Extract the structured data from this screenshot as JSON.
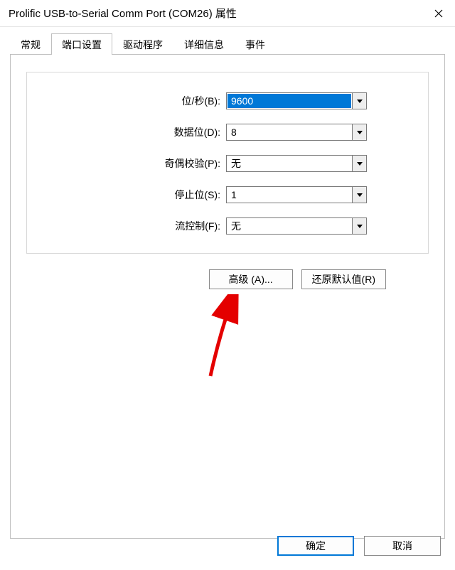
{
  "window": {
    "title": "Prolific USB-to-Serial Comm Port (COM26) 属性"
  },
  "tabs": {
    "general": "常规",
    "port_settings": "端口设置",
    "driver": "驱动程序",
    "details": "详细信息",
    "events": "事件"
  },
  "labels": {
    "bps": "位/秒(B):",
    "data_bits": "数据位(D):",
    "parity": "奇偶校验(P):",
    "stop_bits": "停止位(S):",
    "flow_control": "流控制(F):"
  },
  "values": {
    "bps": "9600",
    "data_bits": "8",
    "parity": "无",
    "stop_bits": "1",
    "flow_control": "无"
  },
  "buttons": {
    "advanced": "高级 (A)...",
    "restore_defaults": "还原默认值(R)",
    "ok": "确定",
    "cancel": "取消"
  }
}
